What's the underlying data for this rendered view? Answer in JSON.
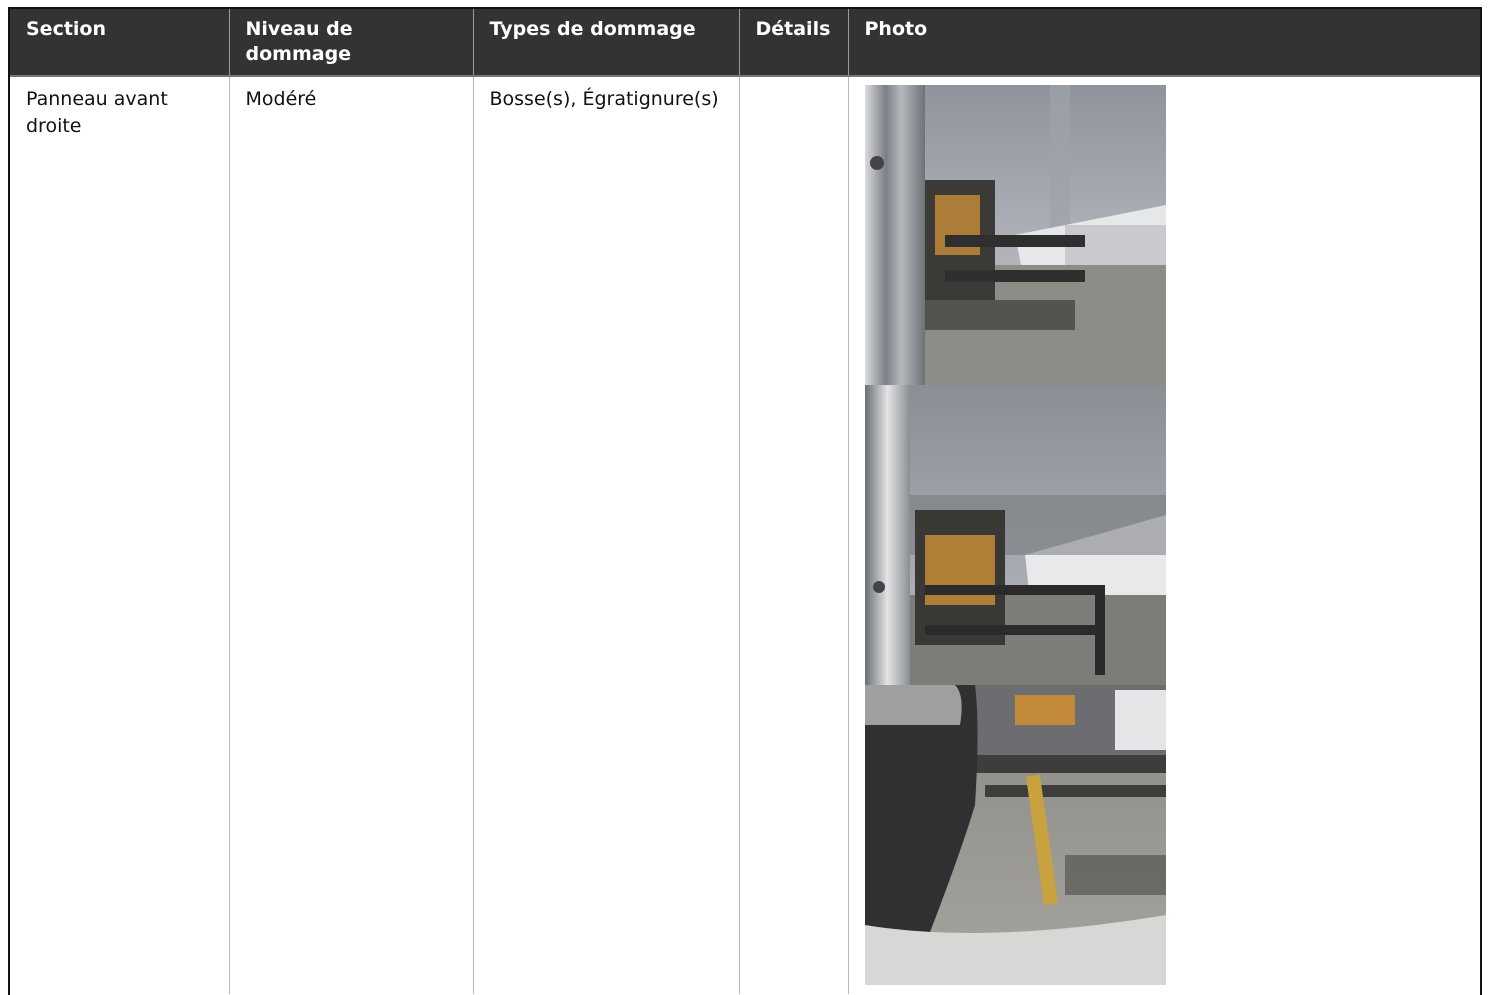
{
  "table": {
    "headers": [
      "Section",
      "Niveau de dommage",
      "Types de dommage",
      "Détails",
      "Photo"
    ],
    "row": {
      "section": "Panneau avant droite",
      "level": "Modéré",
      "types": "Bosse(s), Égratignure(s)",
      "details": ""
    }
  },
  "colors": {
    "header_bg": "#333333",
    "header_text": "#ffffff",
    "border": "#111111"
  }
}
